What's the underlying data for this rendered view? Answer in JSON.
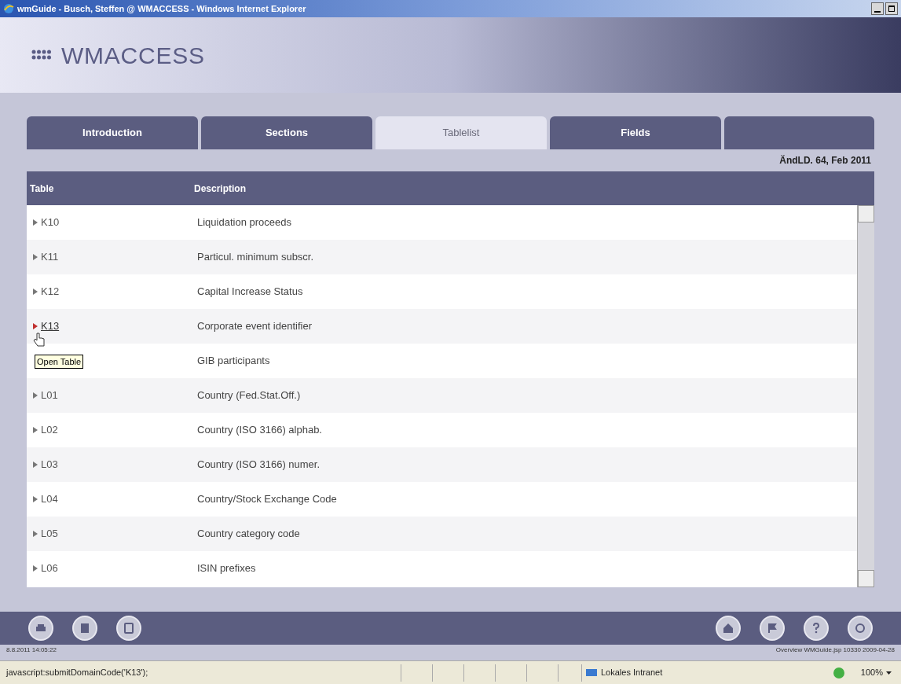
{
  "window": {
    "title": "wmGuide - Busch, Steffen @ WMACCESS - Windows Internet Explorer"
  },
  "header": {
    "logo": "WMACCESS"
  },
  "tabs": [
    {
      "label": "Introduction",
      "selected": false
    },
    {
      "label": "Sections",
      "selected": false
    },
    {
      "label": "Tablelist",
      "selected": true
    },
    {
      "label": "Fields",
      "selected": false
    }
  ],
  "revision": "ÄndLD. 64, Feb 2011",
  "table": {
    "columns": [
      "Table",
      "Description"
    ],
    "rows": [
      {
        "code": "K10",
        "description": "Liquidation proceeds",
        "hovered": false
      },
      {
        "code": "K11",
        "description": "Particul. minimum subscr.",
        "hovered": false
      },
      {
        "code": "K12",
        "description": "Capital Increase Status",
        "hovered": false
      },
      {
        "code": "K13",
        "description": "Corporate event identifier",
        "hovered": true
      },
      {
        "description": "GIB participants",
        "hovered": false
      },
      {
        "code": "L01",
        "description": "Country (Fed.Stat.Off.)",
        "hovered": false
      },
      {
        "code": "L02",
        "description": "Country (ISO 3166) alphab.",
        "hovered": false
      },
      {
        "code": "L03",
        "description": "Country (ISO 3166) numer.",
        "hovered": false
      },
      {
        "code": "L04",
        "description": "Country/Stock Exchange Code",
        "hovered": false
      },
      {
        "code": "L05",
        "description": "Country category code",
        "hovered": false
      },
      {
        "code": "L06",
        "description": "ISIN prefixes",
        "hovered": false
      }
    ]
  },
  "tooltip": "Open Table",
  "footer": {
    "timestamp": "8.8.2011 14:05:22",
    "source": "Overview WMGuide.jsp 10330 2009-04-28"
  },
  "status_bar": {
    "url": "javascript:submitDomainCode('K13');",
    "zone": "Lokales Intranet",
    "zoom": "100%"
  }
}
